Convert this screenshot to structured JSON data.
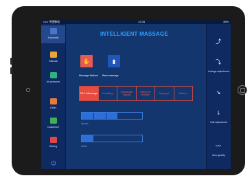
{
  "status": {
    "carrier": "••••• 中国移动",
    "time": "12:34",
    "battery": "35%"
  },
  "title": "INTELLIGENT MASSAGE",
  "nav": [
    {
      "label": "Automatic",
      "color": "#4a74c8",
      "icon": "auto-icon"
    },
    {
      "label": "Manual",
      "color": "#e8a53a",
      "icon": "manual-icon"
    },
    {
      "label": "Air pressure",
      "color": "#2fb380",
      "icon": "air-pressure-icon"
    },
    {
      "label": "Other",
      "color": "#e87b3a",
      "icon": "other-icon"
    },
    {
      "label": "Customize",
      "color": "#3fae5a",
      "icon": "customize-icon"
    },
    {
      "label": "Setting",
      "color": "#e04848",
      "icon": "setting-icon"
    }
  ],
  "methods": [
    {
      "label": "Massage Method",
      "color": "#e85a50",
      "icon": "massage-method-icon"
    },
    {
      "label": "Back massage",
      "color": "#1f56b8",
      "icon": "back-massage-icon"
    }
  ],
  "tabs": [
    {
      "label": "3D 1 Massage",
      "active": true
    },
    {
      "label": "Kneading",
      "active": false
    },
    {
      "label": "Kneading& Tapping",
      "active": false
    },
    {
      "label": "Lifting the shoulder",
      "active": false
    },
    {
      "label": "Tapping 1",
      "active": false
    },
    {
      "label": "Shiatsu 1",
      "active": false
    }
  ],
  "speed": {
    "label": "Speed",
    "segments": 5,
    "level": 3
  },
  "width": {
    "label": "Width",
    "segments": 5,
    "level": 1
  },
  "right": [
    {
      "label": "",
      "icon": "recline-up-icon"
    },
    {
      "label": "Linkage adjustment",
      "icon": "linkage-icon"
    },
    {
      "label": "",
      "icon": "recline-down-icon"
    },
    {
      "label": "Calf adjustment",
      "icon": "calf-icon"
    },
    {
      "label": "Zero gravity",
      "icon": "zero-gravity-icon"
    }
  ]
}
